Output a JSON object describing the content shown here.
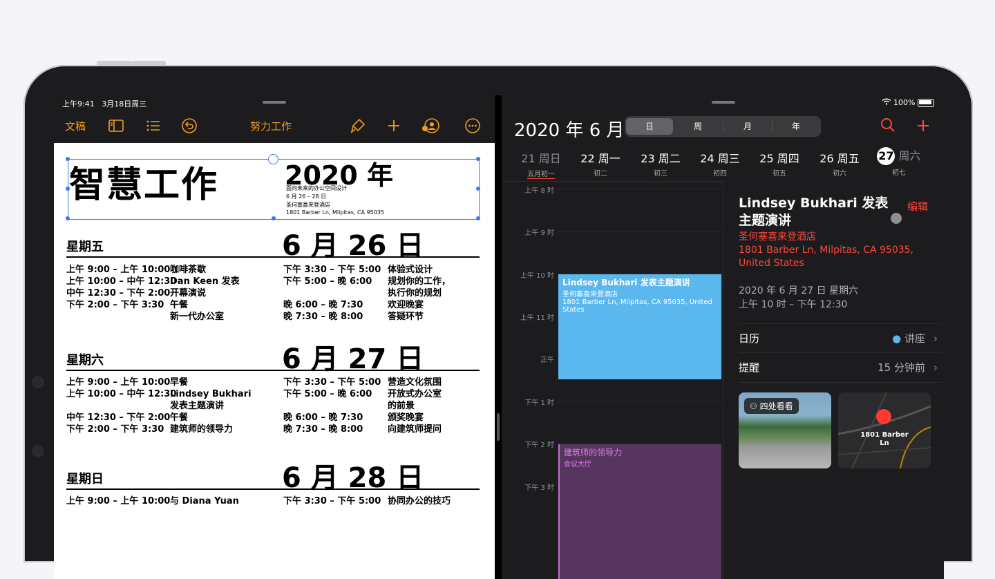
{
  "status_left": {
    "time": "上午9:41",
    "date": "3月18日周三"
  },
  "status_right": {
    "battery": "100%"
  },
  "pages_toolbar": {
    "back": "文稿",
    "doc_title": "努力工作"
  },
  "doc": {
    "title": "智慧工作",
    "year": "2020 年",
    "sub": [
      "面向未来的办公空间设计",
      "6 月 26 – 28 日",
      "圣何塞喜来登酒店",
      "1801 Barber Ln, Milpitas, CA 95035"
    ],
    "days": [
      {
        "name": "星期五",
        "date": "6 月 26 日",
        "left": [
          [
            "上午 9:00 – 上午 10:00",
            "咖啡茶歇"
          ],
          [
            "上午 10:00 – 中午 12:30",
            "Dan Keen 发表"
          ],
          [
            "",
            "开幕演说"
          ],
          [
            "中午 12:30 – 下午 2:00",
            "午餐"
          ],
          [
            "下午 2:00 – 下午 3:30",
            "新一代办公室"
          ]
        ],
        "right": [
          [
            "下午 3:30 – 下午 5:00",
            "体验式设计"
          ],
          [
            "下午 5:00 – 晚 6:00",
            "规划你的工作，"
          ],
          [
            "",
            "执行你的规划"
          ],
          [
            "晚 6:00 – 晚 7:30",
            "欢迎晚宴"
          ],
          [
            "晚 7:30 – 晚 8:00",
            "答疑环节"
          ]
        ]
      },
      {
        "name": "星期六",
        "date": "6 月 27 日",
        "left": [
          [
            "上午 9:00 – 上午 10:00",
            "早餐"
          ],
          [
            "上午 10:00 – 中午 12:30",
            "Lindsey Bukhari"
          ],
          [
            "",
            "发表主题演讲"
          ],
          [
            "中午 12:30 – 下午 2:00",
            "午餐"
          ],
          [
            "下午 2:00 – 下午 3:30",
            "建筑师的领导力"
          ]
        ],
        "right": [
          [
            "下午 3:30 – 下午 5:00",
            "营造文化氛围"
          ],
          [
            "下午 5:00 – 晚 6:00",
            "开放式办公室"
          ],
          [
            "",
            "的前景"
          ],
          [
            "晚 6:00 – 晚 7:30",
            "颁奖晚宴"
          ],
          [
            "晚 7:30 – 晚 8:00",
            "向建筑师提问"
          ]
        ]
      },
      {
        "name": "星期日",
        "date": "6 月 28 日",
        "left": [
          [
            "上午 9:00 – 上午 10:00",
            "与 Diana Yuan"
          ]
        ],
        "right": [
          [
            "下午 3:30 – 下午 5:00",
            "协同办公的技巧"
          ]
        ]
      }
    ]
  },
  "calendar": {
    "title": "2020 年 6 月",
    "segments": [
      "日",
      "周",
      "月",
      "年"
    ],
    "active_segment": "日",
    "week": [
      {
        "d": "21 周日",
        "l": "五月初一"
      },
      {
        "d": "22 周一",
        "l": "初二"
      },
      {
        "d": "23 周二",
        "l": "初三"
      },
      {
        "d": "24 周三",
        "l": "初四"
      },
      {
        "d": "25 周四",
        "l": "初五"
      },
      {
        "d": "26 周五",
        "l": "初六"
      },
      {
        "d": "周六",
        "num": "27",
        "l": "初七"
      }
    ],
    "times": [
      "上午 8 时",
      "上午 9 时",
      "上午 10 时",
      "上午 11 时",
      "正午",
      "下午 1 时",
      "下午 2 时",
      "下午 3 时"
    ],
    "events": [
      {
        "title": "Lindsey Bukhari 发表主题演讲",
        "loc": "圣何塞喜来登酒店",
        "addr": "1801 Barber Ln, Milpitas, CA  95035, United States",
        "color": "#5ab8ee"
      },
      {
        "title": "建筑师的领导力",
        "loc": "会议大厅",
        "color": "#56365e",
        "text_color": "#e07cf0"
      }
    ],
    "detail": {
      "title": "Lindsey Bukhari 发表主题演讲",
      "edit": "编辑",
      "location": "圣何塞喜来登酒店",
      "address1": "1801 Barber Ln, Milpitas, CA  95035,",
      "address2": "United States",
      "date": "2020 年 6 月 27 日 星期六",
      "time": "上午 10 时 – 下午 12:30",
      "calendar_label": "日历",
      "calendar_value": "讲座",
      "alert_label": "提醒",
      "alert_value": "15 分钟前",
      "lookaround": "四处看看",
      "map_label": "1801 Barber Ln"
    }
  }
}
